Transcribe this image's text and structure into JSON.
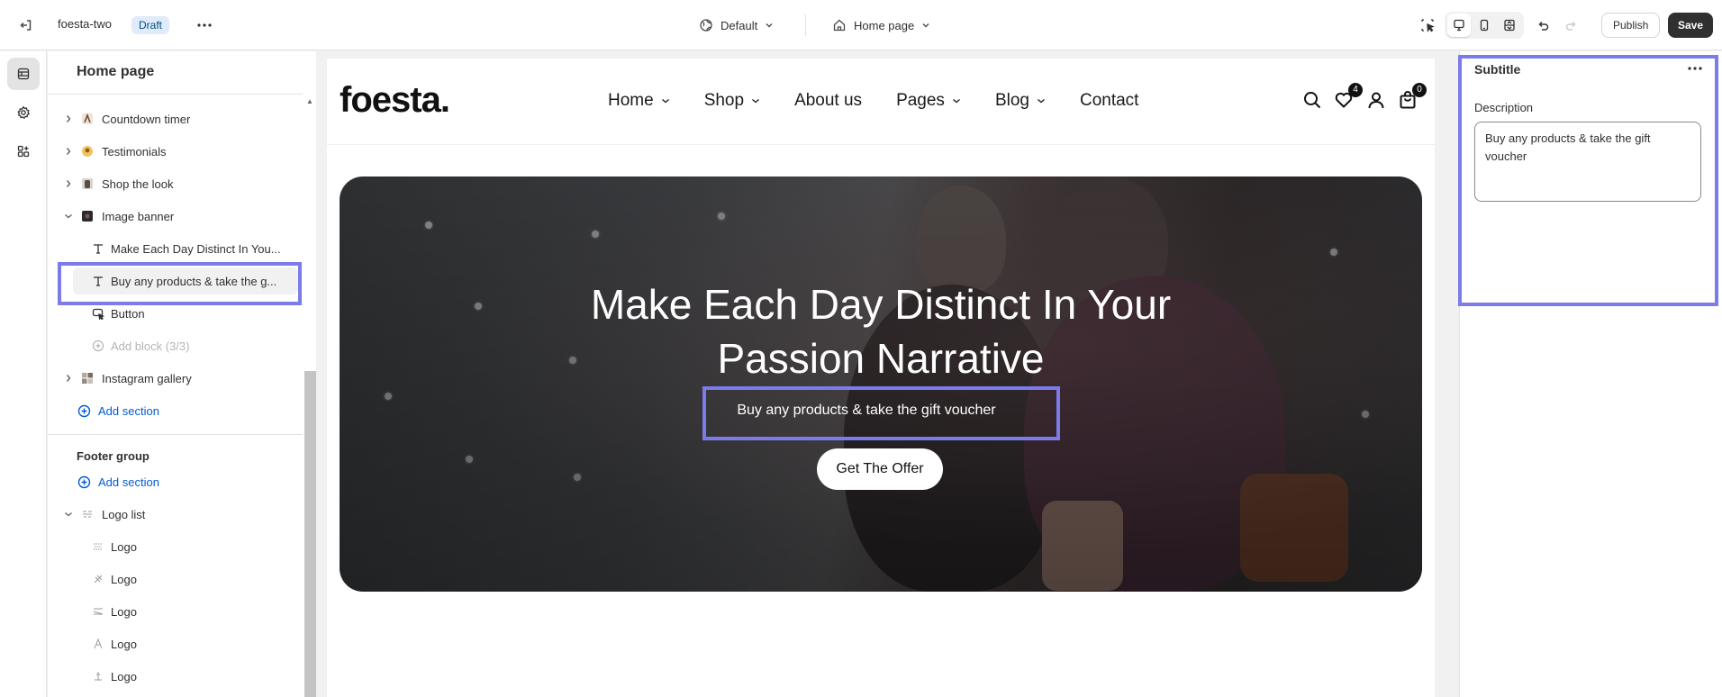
{
  "topbar": {
    "theme_name": "foesta-two",
    "status_badge": "Draft",
    "context_selector": "Default",
    "page_selector": "Home page",
    "publish_label": "Publish",
    "save_label": "Save"
  },
  "sidebar": {
    "title": "Home page",
    "sections": [
      {
        "label": "Countdown timer",
        "icon": "countdown-thumbnail-icon"
      },
      {
        "label": "Testimonials",
        "icon": "testimonials-thumbnail-icon"
      },
      {
        "label": "Shop the look",
        "icon": "shop-the-look-thumbnail-icon"
      },
      {
        "label": "Image banner",
        "icon": "image-banner-thumbnail-icon",
        "expanded": true,
        "blocks": [
          {
            "label": "Make Each Day Distinct In You...",
            "icon": "text-icon"
          },
          {
            "label": "Buy any products & take the g...",
            "icon": "text-icon",
            "selected": true
          },
          {
            "label": "Button",
            "icon": "button-icon"
          },
          {
            "label": "Add block (3/3)",
            "icon": "add-circle-icon",
            "disabled": true
          }
        ]
      },
      {
        "label": "Instagram gallery",
        "icon": "instagram-thumbnail-icon"
      }
    ],
    "add_section_label": "Add section",
    "footer_group": {
      "title": "Footer group",
      "add_section_label": "Add section",
      "logo_list": {
        "label": "Logo list",
        "blocks": [
          "Logo",
          "Logo",
          "Logo",
          "Logo",
          "Logo"
        ]
      }
    }
  },
  "preview": {
    "logo_text": "foesta.",
    "nav": [
      {
        "label": "Home",
        "dropdown": true
      },
      {
        "label": "Shop",
        "dropdown": true
      },
      {
        "label": "About us",
        "dropdown": false
      },
      {
        "label": "Pages",
        "dropdown": true
      },
      {
        "label": "Blog",
        "dropdown": true
      },
      {
        "label": "Contact",
        "dropdown": false
      }
    ],
    "wishlist_count": "4",
    "cart_count": "0",
    "hero": {
      "title_line1": "Make Each Day Distinct In Your",
      "title_line2": "Passion Narrative",
      "subtitle": "Buy any products & take the gift voucher",
      "button_label": "Get The Offer"
    }
  },
  "right_panel": {
    "title": "Subtitle",
    "description_label": "Description",
    "description_value": "Buy any products & take the gift voucher"
  },
  "colors": {
    "highlight": "#7b7bea",
    "link": "#005bd3",
    "save_bg": "#303030"
  }
}
